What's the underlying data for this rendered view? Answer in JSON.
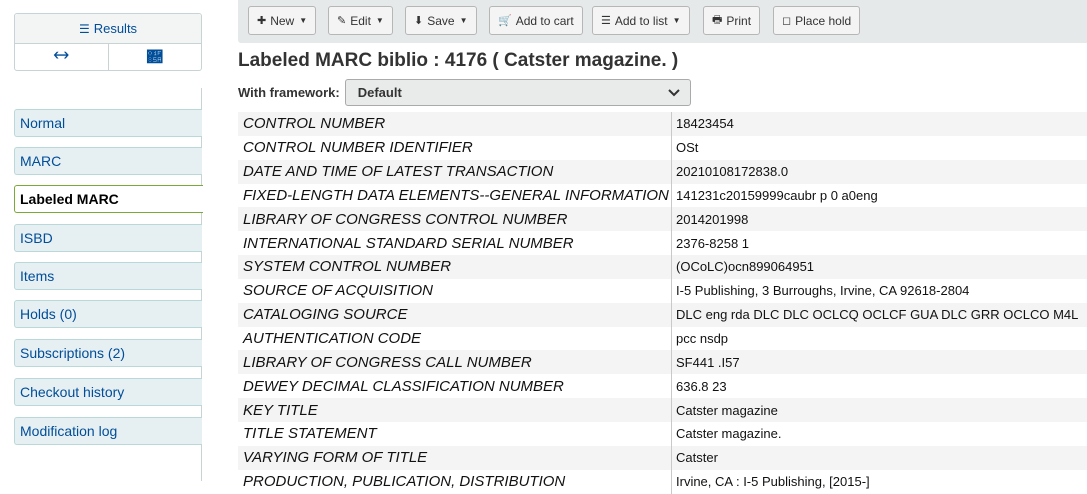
{
  "results": {
    "label": "Results",
    "icon": "list-icon",
    "prev_icon": "arrow-left-icon",
    "next_icon": "arrow-right-icon"
  },
  "menu": {
    "items": [
      {
        "label": "Normal"
      },
      {
        "label": "MARC"
      },
      {
        "label": "Labeled MARC",
        "active": true
      },
      {
        "label": "ISBD"
      },
      {
        "label": "Items"
      },
      {
        "label": "Holds (0)"
      },
      {
        "label": "Subscriptions (2)"
      },
      {
        "label": "Checkout history"
      },
      {
        "label": "Modification log"
      }
    ]
  },
  "toolbar": {
    "new_label": "New",
    "edit_label": "Edit",
    "save_label": "Save",
    "add_to_cart_label": "Add to cart",
    "add_to_list_label": "Add to list",
    "print_label": "Print",
    "place_hold_label": "Place hold"
  },
  "page": {
    "title": "Labeled MARC biblio : 4176 ( Catster magazine. )",
    "framework_label": "With framework:",
    "framework_value": "Default"
  },
  "marc_rows": [
    {
      "label": "CONTROL NUMBER",
      "value": "18423454"
    },
    {
      "label": "CONTROL NUMBER IDENTIFIER",
      "value": "OSt"
    },
    {
      "label": "DATE AND TIME OF LATEST TRANSACTION",
      "value": "20210108172838.0"
    },
    {
      "label": "FIXED-LENGTH DATA ELEMENTS--GENERAL INFORMATION",
      "value": "141231c20159999caubr p 0 a0eng"
    },
    {
      "label": "LIBRARY OF CONGRESS CONTROL NUMBER",
      "value": "2014201998"
    },
    {
      "label": "INTERNATIONAL STANDARD SERIAL NUMBER",
      "value": "2376-8258 1"
    },
    {
      "label": "SYSTEM CONTROL NUMBER",
      "value": "(OCoLC)ocn899064951"
    },
    {
      "label": "SOURCE OF ACQUISITION",
      "value": "I-5 Publishing, 3 Burroughs, Irvine, CA 92618-2804"
    },
    {
      "label": "CATALOGING SOURCE",
      "value": "DLC eng rda DLC DLC OCLCQ OCLCF GUA DLC GRR OCLCO M4L"
    },
    {
      "label": "AUTHENTICATION CODE",
      "value": "pcc nsdp"
    },
    {
      "label": "LIBRARY OF CONGRESS CALL NUMBER",
      "value": "SF441 .I57"
    },
    {
      "label": "DEWEY DECIMAL CLASSIFICATION NUMBER",
      "value": "636.8 23"
    },
    {
      "label": "KEY TITLE",
      "value": "Catster magazine"
    },
    {
      "label": "TITLE STATEMENT",
      "value": "Catster magazine."
    },
    {
      "label": "VARYING FORM OF TITLE",
      "value": "Catster"
    },
    {
      "label": "PRODUCTION, PUBLICATION, DISTRIBUTION",
      "value": "Irvine, CA : I-5 Publishing, [2015-]"
    }
  ]
}
